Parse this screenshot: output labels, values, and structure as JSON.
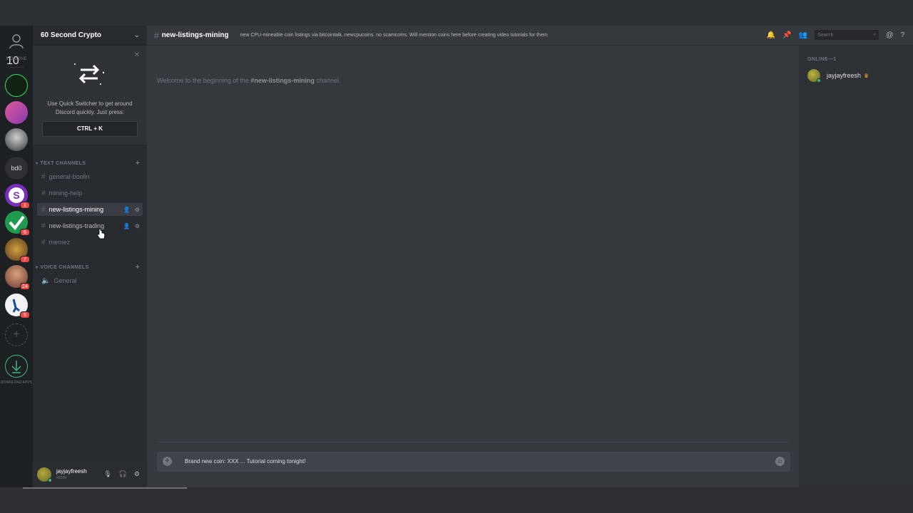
{
  "server": {
    "name": "60 Second Crypto"
  },
  "friends": {
    "online_label": "1 ONLINE",
    "badge": "10"
  },
  "guilds": [
    {
      "name": "60 second crypto",
      "color": "#1a2b1a",
      "badge": ""
    },
    {
      "name": "pink server",
      "color": "#c2447a",
      "badge": ""
    },
    {
      "name": "portrait server",
      "color": "#3a3a3a",
      "badge": ""
    },
    {
      "name": "bd0",
      "label": "bd0",
      "color": "#2f3136",
      "badge": ""
    },
    {
      "name": "S server",
      "color": "#7b2fbe",
      "badge": "1"
    },
    {
      "name": "check server",
      "color": "#1f9b4f",
      "badge": "6"
    },
    {
      "name": "artwork server",
      "color": "#8a6a2a",
      "badge": "7"
    },
    {
      "name": "face server",
      "color": "#a05a3a",
      "badge": "24"
    },
    {
      "name": "rabbit server",
      "color": "#f2f2f2",
      "badge": "5"
    }
  ],
  "download_label": "DOWNLOAD APPS",
  "quick_switcher": {
    "text": "Use Quick Switcher to get around Discord quickly. Just press:",
    "key": "CTRL + K"
  },
  "categories": {
    "text": "TEXT CHANNELS",
    "voice": "VOICE CHANNELS"
  },
  "text_channels": [
    {
      "name": "general-boolin"
    },
    {
      "name": "mining-help"
    },
    {
      "name": "new-listings-mining"
    },
    {
      "name": "new-listings-trading"
    },
    {
      "name": "memez"
    }
  ],
  "voice_channels": [
    {
      "name": "General"
    }
  ],
  "user": {
    "name": "jayjayfreesh",
    "tag": "#6289"
  },
  "header": {
    "channel": "new-listings-mining",
    "topic": "new CPU-mineable coin listings via bitcointalk, newcpucoins. no scamcoins. Will mention coins here before creating video tutorials for them",
    "search_placeholder": "Search"
  },
  "welcome": {
    "prefix": "Welcome to the beginning of the ",
    "channel": "#new-listings-mining",
    "suffix": " channel."
  },
  "composer": {
    "text": "Brand new coin:  XXX ... Tutorial coming tonight!"
  },
  "members": {
    "heading": "ONLINE—1",
    "list": [
      {
        "name": "jayjayfreesh"
      }
    ]
  }
}
